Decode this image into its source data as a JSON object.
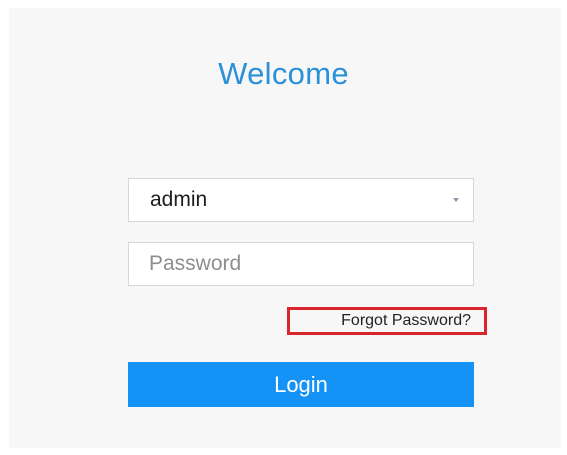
{
  "title": "Welcome",
  "username": {
    "value": "admin",
    "dropdown_icon": "caret-down-icon"
  },
  "password": {
    "placeholder": "Password",
    "value": ""
  },
  "forgot_password": {
    "label": "Forgot Password?",
    "highlight_color": "#d9262c"
  },
  "login": {
    "label": "Login"
  },
  "colors": {
    "accent": "#1592f5",
    "title": "#2a90d8"
  }
}
